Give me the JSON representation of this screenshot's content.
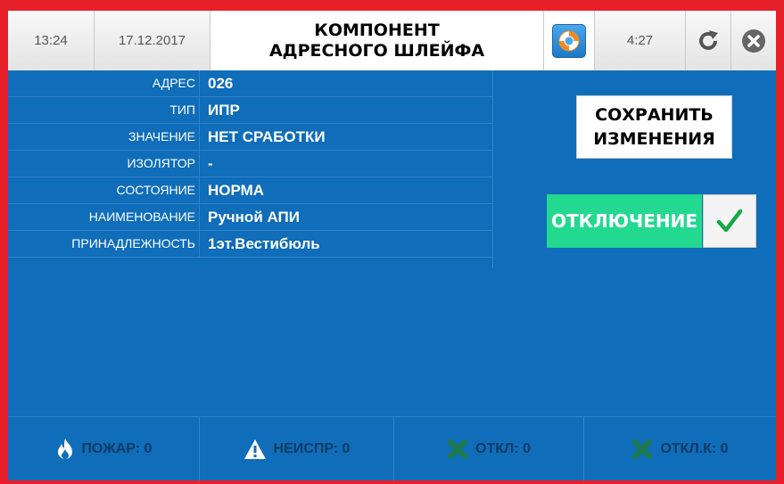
{
  "header": {
    "time": "13:24",
    "date": "17.12.2017",
    "title_line1": "КОМПОНЕНТ",
    "title_line2": "АДРЕСНОГО ШЛЕЙФА",
    "timer": "4:27",
    "icons": [
      "lifebuoy-icon",
      "refresh-icon",
      "close-icon"
    ]
  },
  "properties": [
    {
      "label": "АДРЕС",
      "value": "026"
    },
    {
      "label": "ТИП",
      "value": "ИПР"
    },
    {
      "label": "ЗНАЧЕНИЕ",
      "value": "НЕТ СРАБОТКИ"
    },
    {
      "label": "ИЗОЛЯТОР",
      "value": "-"
    },
    {
      "label": "СОСТОЯНИЕ",
      "value": "НОРМА"
    },
    {
      "label": "НАИМЕНОВАНИЕ",
      "value": "Ручной АПИ"
    },
    {
      "label": "ПРИНАДЛЕЖНОСТЬ",
      "value": "1эт.Вестибюль"
    }
  ],
  "actions": {
    "save_line1": "СОХРАНИТЬ",
    "save_line2": "ИЗМЕНЕНИЯ",
    "disable_label": "ОТКЛЮЧЕНИЕ",
    "disable_checked": true
  },
  "status": {
    "fire": "ПОЖАР: 0",
    "fault": "НЕИСПР: 0",
    "disabled": "ОТКЛ: 0",
    "disabled_k": "ОТКЛ.К: 0"
  },
  "colors": {
    "frame": "#e8202a",
    "panel": "#0f6dba",
    "accent_green": "#23d98f"
  }
}
